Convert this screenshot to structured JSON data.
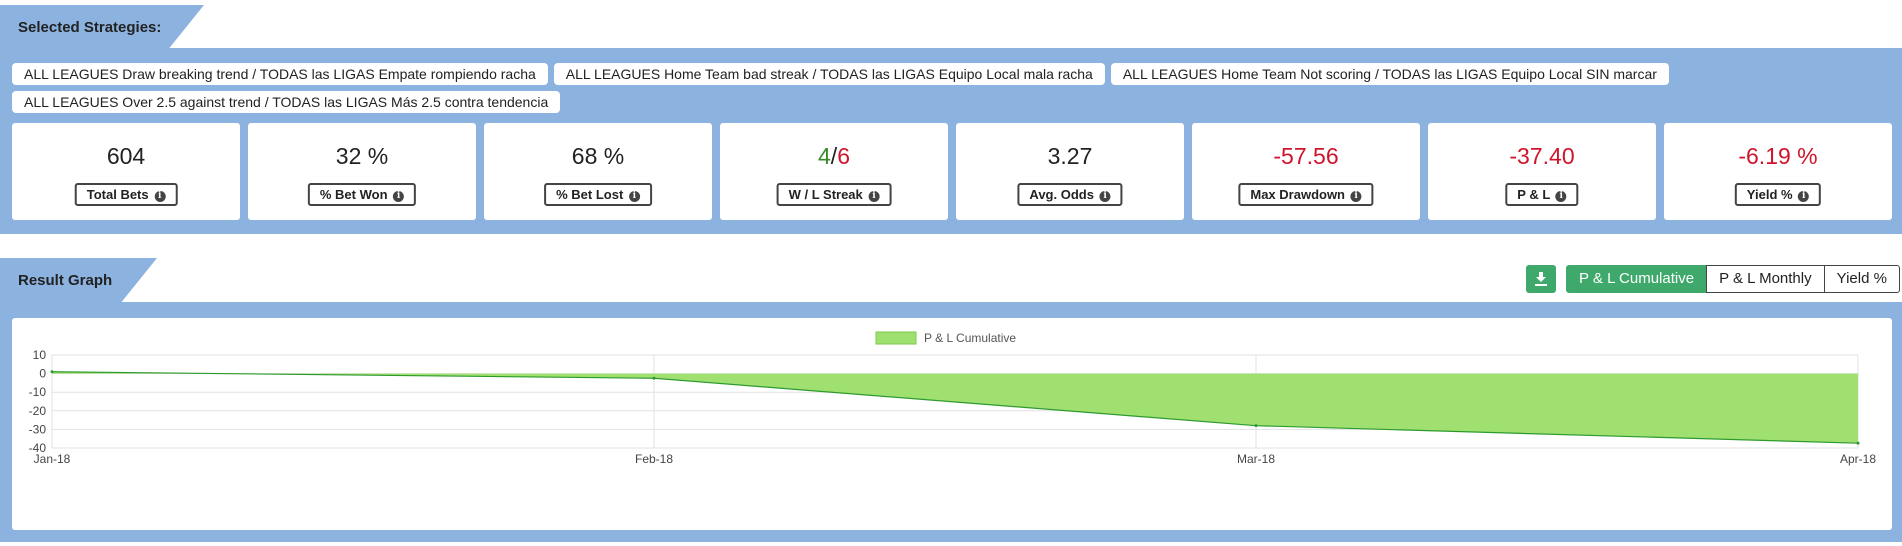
{
  "selected_strategies": {
    "heading": "Selected Strategies:",
    "items": [
      "ALL LEAGUES Draw breaking trend / TODAS las LIGAS Empate rompiendo racha",
      "ALL LEAGUES Home Team bad streak / TODAS las LIGAS Equipo Local mala racha",
      "ALL LEAGUES Home Team Not scoring / TODAS las LIGAS Equipo Local SIN marcar",
      "ALL LEAGUES Over 2.5 against trend / TODAS las LIGAS Más 2.5 contra tendencia"
    ]
  },
  "stats": {
    "total_bets": {
      "value": "604",
      "label": "Total Bets"
    },
    "bet_won": {
      "value": "32 %",
      "label": "% Bet Won"
    },
    "bet_lost": {
      "value": "68 %",
      "label": "% Bet Lost"
    },
    "streak": {
      "win": "4",
      "sep": "/",
      "loss": "6",
      "label": "W / L Streak"
    },
    "avg_odds": {
      "value": "3.27",
      "label": "Avg. Odds"
    },
    "max_drawdown": {
      "value": "-57.56",
      "label": "Max Drawdown"
    },
    "pl": {
      "value": "-37.40",
      "label": "P & L"
    },
    "yield": {
      "value": "-6.19 %",
      "label": "Yield %"
    }
  },
  "result_graph": {
    "heading": "Result Graph",
    "download_icon": "download-icon",
    "toggles": [
      "P & L Cumulative",
      "P & L Monthly",
      "Yield %"
    ],
    "active_toggle": "P & L Cumulative"
  },
  "colors": {
    "panel": "#8cb3e0",
    "accent_green": "#3fa96b",
    "negative": "#d0142c",
    "positive": "#3a8a2a",
    "area_fill": "#a0e070",
    "line": "#2e9a2e"
  },
  "chart_data": {
    "type": "area",
    "title": "",
    "xlabel": "",
    "ylabel": "",
    "x": [
      "Jan-18",
      "Feb-18",
      "Mar-18",
      "Apr-18"
    ],
    "series": [
      {
        "name": "P & L Cumulative",
        "values": [
          1,
          -2.5,
          -28,
          -37.4
        ]
      }
    ],
    "ylim": [
      -40,
      10
    ],
    "yticks": [
      10,
      0,
      -10,
      -20,
      -30,
      -40
    ],
    "legend": "top-center",
    "grid": true
  }
}
